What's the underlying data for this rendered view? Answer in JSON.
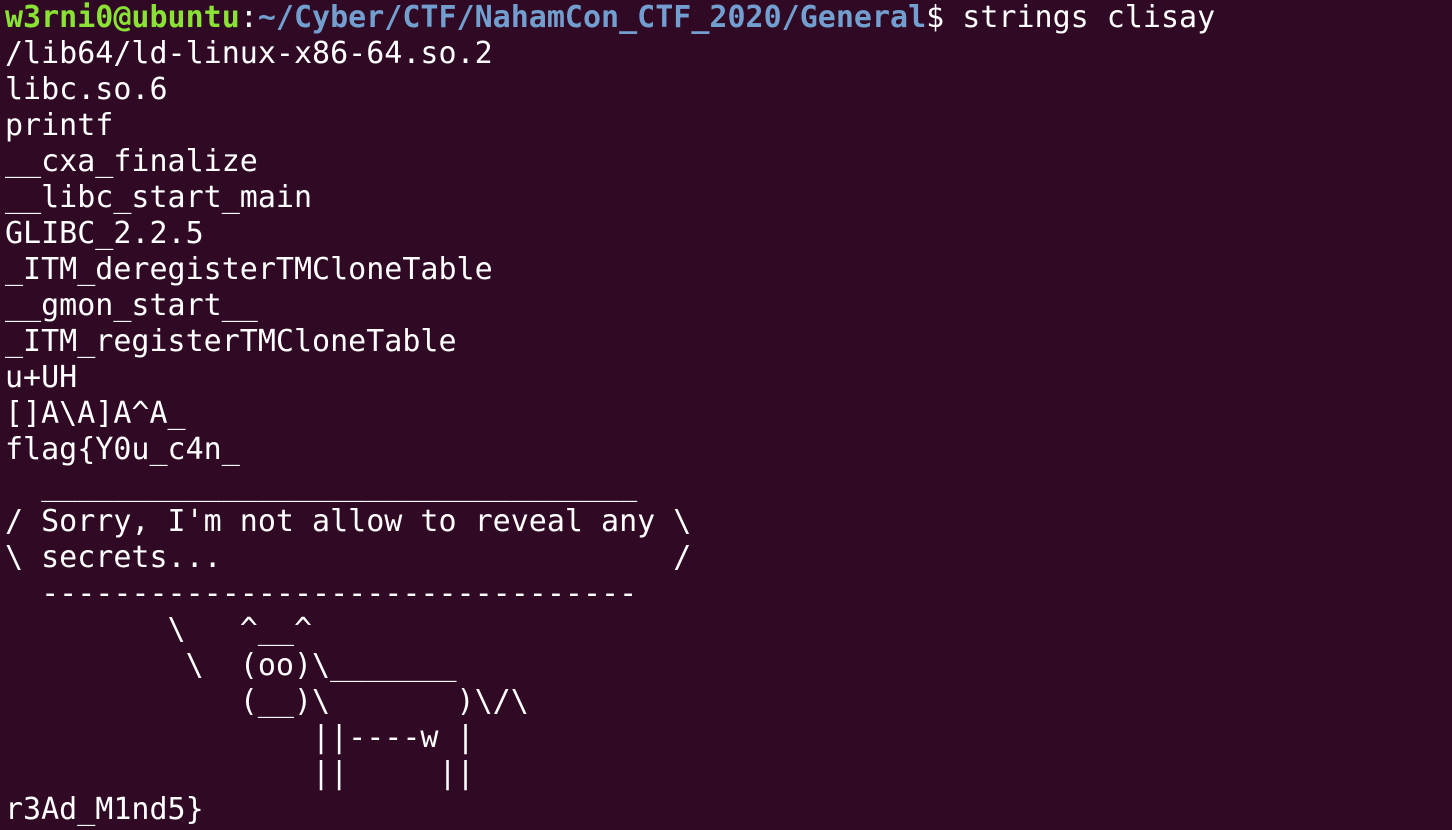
{
  "colors": {
    "background": "#300a24",
    "text": "#ffffff",
    "prompt_user": "#8ae234",
    "prompt_path": "#729fcf"
  },
  "prompt": {
    "user_host": "w3rni0@ubuntu",
    "colon": ":",
    "path": "~/Cyber/CTF/NahamCon_CTF_2020/General",
    "dollar": "$ ",
    "command": "strings clisay"
  },
  "output_lines": [
    "/lib64/ld-linux-x86-64.so.2",
    "libc.so.6",
    "printf",
    "__cxa_finalize",
    "__libc_start_main",
    "GLIBC_2.2.5",
    "_ITM_deregisterTMCloneTable",
    "__gmon_start__",
    "_ITM_registerTMCloneTable",
    "u+UH",
    "[]A\\A]A^A_",
    "flag{Y0u_c4n_",
    "  _________________________________",
    "/ Sorry, I'm not allow to reveal any \\",
    "\\ secrets...                         /",
    "  ---------------------------------",
    "         \\   ^__^",
    "          \\  (oo)\\_______",
    "             (__)\\       )\\/\\",
    "                 ||----w |",
    "                 ||     ||",
    "r3Ad_M1nd5}"
  ]
}
